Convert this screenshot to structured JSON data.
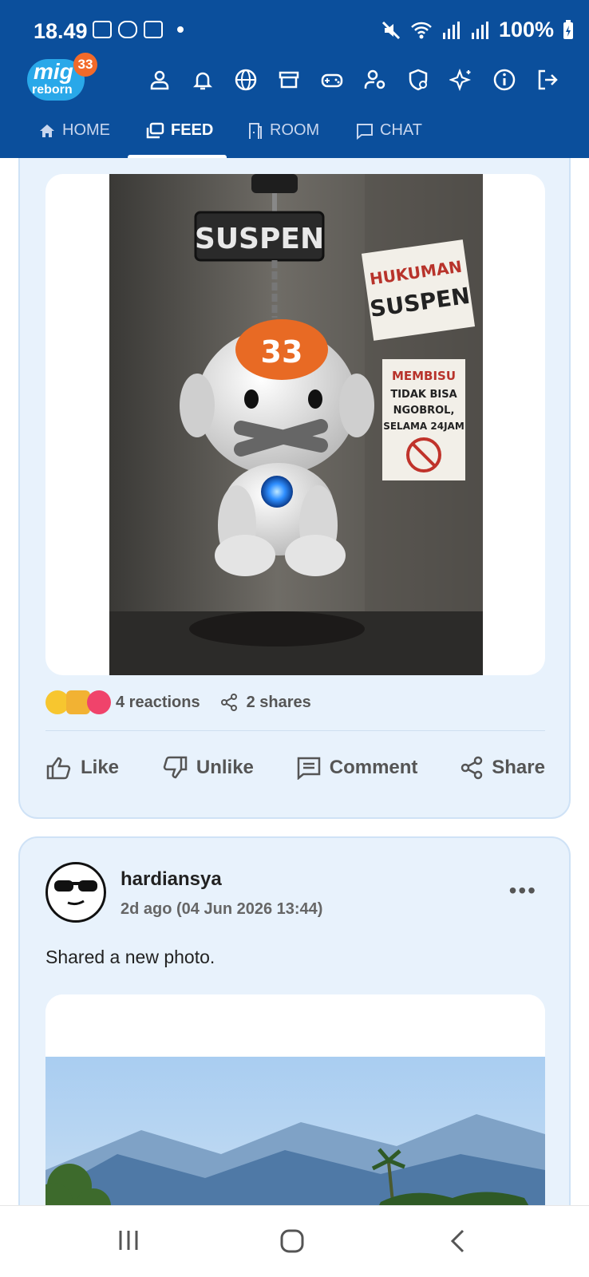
{
  "status": {
    "time": "18.49",
    "battery": "100%"
  },
  "app": {
    "logo_text": "mig",
    "logo_sub": "reborn",
    "logo_badge": "33"
  },
  "tabs": [
    {
      "label": "HOME",
      "icon": "home-icon"
    },
    {
      "label": "FEED",
      "icon": "feed-icon",
      "active": true
    },
    {
      "label": "ROOM",
      "icon": "room-icon"
    },
    {
      "label": "CHAT",
      "icon": "chat-icon"
    }
  ],
  "post1": {
    "image_texts": {
      "sign": "SUSPEN",
      "head_badge": "33",
      "poster1_l1": "HUKUMAN",
      "poster1_l2": "SUSPEN",
      "poster2_l1": "MEMBISU",
      "poster2_l2": "TIDAK BISA",
      "poster2_l3": "NGOBROL,",
      "poster2_l4": "SELAMA 24JAM"
    },
    "reactions": "4 reactions",
    "shares": "2 shares",
    "actions": {
      "like": "Like",
      "unlike": "Unlike",
      "comment": "Comment",
      "share": "Share"
    }
  },
  "post2": {
    "username": "hardiansya",
    "time": "2d ago (04 Jun 2026 13:44)",
    "text": "Shared a new photo.",
    "more": "•••"
  },
  "colors": {
    "header": "#0b4f9c",
    "card_bg": "#e8f2fc",
    "accent": "#29a8e9"
  }
}
